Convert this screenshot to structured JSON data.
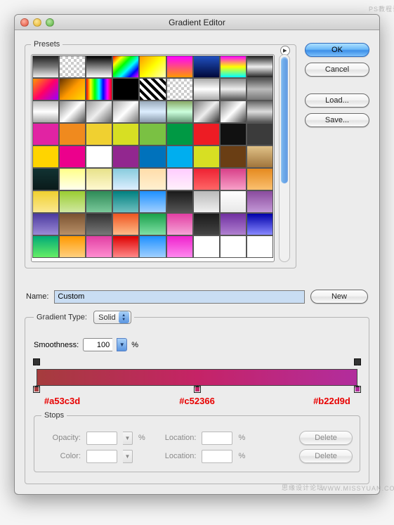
{
  "window": {
    "title": "Gradient Editor"
  },
  "buttons": {
    "ok": "OK",
    "cancel": "Cancel",
    "load": "Load...",
    "save": "Save...",
    "new": "New",
    "delete": "Delete"
  },
  "presets": {
    "legend": "Presets"
  },
  "name": {
    "label": "Name:",
    "value": "Custom"
  },
  "gradient_type": {
    "legend": "Gradient Type:",
    "value": "Solid"
  },
  "smoothness": {
    "label": "Smoothness:",
    "value": "100",
    "unit": "%"
  },
  "stops_panel": {
    "legend": "Stops",
    "opacity_label": "Opacity:",
    "color_label": "Color:",
    "location_label": "Location:",
    "unit": "%"
  },
  "color_stops": [
    {
      "hex": "#a53c3d",
      "position": 0
    },
    {
      "hex": "#c52366",
      "position": 50
    },
    {
      "hex": "#b22d9d",
      "position": 100
    }
  ],
  "opacity_stops": [
    {
      "position": 0
    },
    {
      "position": 100
    }
  ],
  "swatch_rows": [
    [
      "linear-gradient(#222,#777,#eee)",
      "repeating-conic-gradient(#fff 0 25%,#ccc 0 50%) 0 0/8px 8px",
      "linear-gradient(#000,#fff)",
      "linear-gradient(135deg,#f00,#ff0,#0f0,#0ff,#00f,#f0f)",
      "linear-gradient(135deg,#f90,#ff0,#ffb)",
      "linear-gradient(#f0f,#f90)",
      "linear-gradient(#2050c0,#00083a)",
      "linear-gradient(#f0f,#ff0,#0ff)",
      "linear-gradient(#222,#888,#eee,#888,#222)"
    ],
    [
      "linear-gradient(135deg,#f90,#f06,#90f)",
      "linear-gradient(135deg,#630,#f90,#fd0)",
      "linear-gradient(90deg,#f00,#ff0,#0f0,#0ff,#00f,#f0f,#f00)",
      "#000",
      "repeating-linear-gradient(45deg,#000 0 4px,#fff 4px 8px)",
      "repeating-conic-gradient(#fff 0 25%,#ccc 0 50%) 0 0/8px 8px",
      "linear-gradient(#aaa,#fff,#aaa)",
      "linear-gradient(#888,#eee,#555)",
      "linear-gradient(#555,#bbb,#777)"
    ],
    [
      "linear-gradient(#bbb,#fff,#aaa)",
      "linear-gradient(135deg,#888,#fff,#555)",
      "linear-gradient(135deg,#999,#eee,#666)",
      "linear-gradient(135deg,#aaa,#fff,#777)",
      "linear-gradient(#9ab,#def,#89a)",
      "linear-gradient(#8a6,#cfd,#697)",
      "linear-gradient(135deg,#777,#eee,#333)",
      "linear-gradient(135deg,#888,#fff,#444)",
      "linear-gradient(#666,#ddd,#555)"
    ],
    [
      "#e123a3",
      "#f08a1e",
      "#f0d030",
      "#d7df23",
      "#7ac143",
      "#009944",
      "#ed1c24",
      "#111111",
      "#3b3b3b"
    ],
    [
      "#ffd400",
      "#ec008c",
      "#ffffff",
      "#92278f",
      "#0072bc",
      "#00aeef",
      "#d7df23",
      "#6a3e14",
      "linear-gradient(#e0c187,#a0753c)"
    ],
    [
      "linear-gradient(#133,#0a1a1a)",
      "linear-gradient(#ff8,#ffe)",
      "linear-gradient(#e7e28a,#fff8d0)",
      "linear-gradient(#8cd,#def)",
      "linear-gradient(#fda,#fff0d0)",
      "linear-gradient(#fcf,#fff0fb)",
      "linear-gradient(#e23,#f66)",
      "linear-gradient(#d84089,#f8a0c8)",
      "linear-gradient(#e58a1f,#fac070)"
    ],
    [
      "linear-gradient(#f0d030,#fbe890)",
      "linear-gradient(#9acd32,#d0e8a0)",
      "linear-gradient(#2e8b57,#7ac89a)",
      "linear-gradient(#008080,#70c0c0)",
      "linear-gradient(#1e90ff,#a0d0ff)",
      "linear-gradient(#1a1a1a,#555)",
      "linear-gradient(#bababa,#f0f0f0)",
      "linear-gradient(#ffffff,#e8e8e8)",
      "linear-gradient(#8a4b9e,#c398d6)"
    ],
    [
      "linear-gradient(#4b3a9e,#9b8ad6)",
      "linear-gradient(#7a5230,#b89068)",
      "linear-gradient(#333,#777)",
      "linear-gradient(#e52,#fb8)",
      "linear-gradient(#1aa04a,#7fe0a5)",
      "linear-gradient(#e23fa3,#f6a3d6)",
      "linear-gradient(#1a1a1a,#444)",
      "linear-gradient(#7030a0,#b080d0)",
      "linear-gradient(#00a,#88f)"
    ],
    [
      "linear-gradient(#0a7,#6e6)",
      "linear-gradient(#f90,#ffd080)",
      "linear-gradient(#e23fa3,#ff8ed0)",
      "linear-gradient(#d00,#f88)",
      "linear-gradient(#1e90ff,#a0d0ff)",
      "linear-gradient(#e2c,#f8e)",
      "#ffffff",
      "#ffffff",
      "#ffffff"
    ]
  ],
  "watermark": {
    "top": "PS教程论坛",
    "bottom_left": "思缘设计论坛",
    "bottom_right": "WWW.MISSYUAN.COM"
  }
}
